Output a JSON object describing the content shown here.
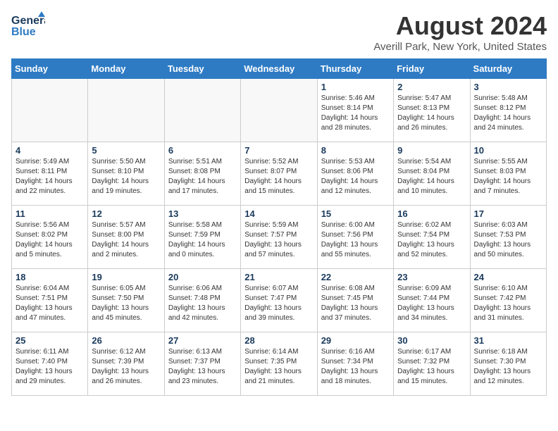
{
  "logo": {
    "general": "General",
    "blue": "Blue"
  },
  "title": "August 2024",
  "location": "Averill Park, New York, United States",
  "weekdays": [
    "Sunday",
    "Monday",
    "Tuesday",
    "Wednesday",
    "Thursday",
    "Friday",
    "Saturday"
  ],
  "weeks": [
    [
      {
        "day": "",
        "info": ""
      },
      {
        "day": "",
        "info": ""
      },
      {
        "day": "",
        "info": ""
      },
      {
        "day": "",
        "info": ""
      },
      {
        "day": "1",
        "info": "Sunrise: 5:46 AM\nSunset: 8:14 PM\nDaylight: 14 hours\nand 28 minutes."
      },
      {
        "day": "2",
        "info": "Sunrise: 5:47 AM\nSunset: 8:13 PM\nDaylight: 14 hours\nand 26 minutes."
      },
      {
        "day": "3",
        "info": "Sunrise: 5:48 AM\nSunset: 8:12 PM\nDaylight: 14 hours\nand 24 minutes."
      }
    ],
    [
      {
        "day": "4",
        "info": "Sunrise: 5:49 AM\nSunset: 8:11 PM\nDaylight: 14 hours\nand 22 minutes."
      },
      {
        "day": "5",
        "info": "Sunrise: 5:50 AM\nSunset: 8:10 PM\nDaylight: 14 hours\nand 19 minutes."
      },
      {
        "day": "6",
        "info": "Sunrise: 5:51 AM\nSunset: 8:08 PM\nDaylight: 14 hours\nand 17 minutes."
      },
      {
        "day": "7",
        "info": "Sunrise: 5:52 AM\nSunset: 8:07 PM\nDaylight: 14 hours\nand 15 minutes."
      },
      {
        "day": "8",
        "info": "Sunrise: 5:53 AM\nSunset: 8:06 PM\nDaylight: 14 hours\nand 12 minutes."
      },
      {
        "day": "9",
        "info": "Sunrise: 5:54 AM\nSunset: 8:04 PM\nDaylight: 14 hours\nand 10 minutes."
      },
      {
        "day": "10",
        "info": "Sunrise: 5:55 AM\nSunset: 8:03 PM\nDaylight: 14 hours\nand 7 minutes."
      }
    ],
    [
      {
        "day": "11",
        "info": "Sunrise: 5:56 AM\nSunset: 8:02 PM\nDaylight: 14 hours\nand 5 minutes."
      },
      {
        "day": "12",
        "info": "Sunrise: 5:57 AM\nSunset: 8:00 PM\nDaylight: 14 hours\nand 2 minutes."
      },
      {
        "day": "13",
        "info": "Sunrise: 5:58 AM\nSunset: 7:59 PM\nDaylight: 14 hours\nand 0 minutes."
      },
      {
        "day": "14",
        "info": "Sunrise: 5:59 AM\nSunset: 7:57 PM\nDaylight: 13 hours\nand 57 minutes."
      },
      {
        "day": "15",
        "info": "Sunrise: 6:00 AM\nSunset: 7:56 PM\nDaylight: 13 hours\nand 55 minutes."
      },
      {
        "day": "16",
        "info": "Sunrise: 6:02 AM\nSunset: 7:54 PM\nDaylight: 13 hours\nand 52 minutes."
      },
      {
        "day": "17",
        "info": "Sunrise: 6:03 AM\nSunset: 7:53 PM\nDaylight: 13 hours\nand 50 minutes."
      }
    ],
    [
      {
        "day": "18",
        "info": "Sunrise: 6:04 AM\nSunset: 7:51 PM\nDaylight: 13 hours\nand 47 minutes."
      },
      {
        "day": "19",
        "info": "Sunrise: 6:05 AM\nSunset: 7:50 PM\nDaylight: 13 hours\nand 45 minutes."
      },
      {
        "day": "20",
        "info": "Sunrise: 6:06 AM\nSunset: 7:48 PM\nDaylight: 13 hours\nand 42 minutes."
      },
      {
        "day": "21",
        "info": "Sunrise: 6:07 AM\nSunset: 7:47 PM\nDaylight: 13 hours\nand 39 minutes."
      },
      {
        "day": "22",
        "info": "Sunrise: 6:08 AM\nSunset: 7:45 PM\nDaylight: 13 hours\nand 37 minutes."
      },
      {
        "day": "23",
        "info": "Sunrise: 6:09 AM\nSunset: 7:44 PM\nDaylight: 13 hours\nand 34 minutes."
      },
      {
        "day": "24",
        "info": "Sunrise: 6:10 AM\nSunset: 7:42 PM\nDaylight: 13 hours\nand 31 minutes."
      }
    ],
    [
      {
        "day": "25",
        "info": "Sunrise: 6:11 AM\nSunset: 7:40 PM\nDaylight: 13 hours\nand 29 minutes."
      },
      {
        "day": "26",
        "info": "Sunrise: 6:12 AM\nSunset: 7:39 PM\nDaylight: 13 hours\nand 26 minutes."
      },
      {
        "day": "27",
        "info": "Sunrise: 6:13 AM\nSunset: 7:37 PM\nDaylight: 13 hours\nand 23 minutes."
      },
      {
        "day": "28",
        "info": "Sunrise: 6:14 AM\nSunset: 7:35 PM\nDaylight: 13 hours\nand 21 minutes."
      },
      {
        "day": "29",
        "info": "Sunrise: 6:16 AM\nSunset: 7:34 PM\nDaylight: 13 hours\nand 18 minutes."
      },
      {
        "day": "30",
        "info": "Sunrise: 6:17 AM\nSunset: 7:32 PM\nDaylight: 13 hours\nand 15 minutes."
      },
      {
        "day": "31",
        "info": "Sunrise: 6:18 AM\nSunset: 7:30 PM\nDaylight: 13 hours\nand 12 minutes."
      }
    ]
  ]
}
